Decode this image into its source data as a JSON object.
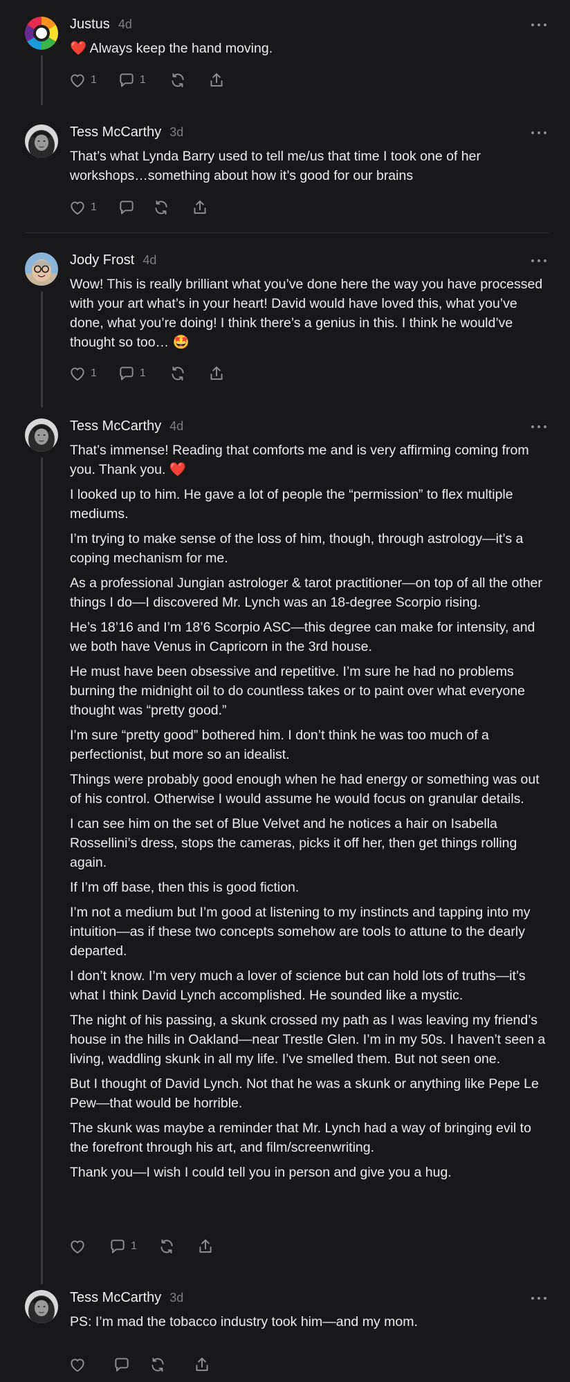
{
  "comments": [
    {
      "author": "Justus",
      "time": "4d",
      "paragraphs": [
        "❤️ Always keep the hand moving."
      ],
      "like_count": "1",
      "reply_count": "1"
    },
    {
      "author": "Tess McCarthy",
      "time": "3d",
      "paragraphs": [
        "That’s what Lynda Barry used to tell me/us that time I took one of her workshops…something about how it’s good for our brains"
      ],
      "like_count": "1",
      "reply_count": ""
    },
    {
      "author": "Jody Frost",
      "time": "4d",
      "paragraphs": [
        "Wow! This is really brilliant what you’ve done here the way you have processed with your art what’s in your heart! David would have loved this, what you’ve done, what you’re doing! I think there’s a genius in this. I think he would’ve thought so too… 🤩"
      ],
      "like_count": "1",
      "reply_count": "1"
    },
    {
      "author": "Tess McCarthy",
      "time": "4d",
      "paragraphs": [
        "That’s immense! Reading that comforts me and is very affirming coming from you. Thank you. ❤️",
        "I looked up to him. He gave a lot of people the “permission” to flex multiple mediums.",
        "I’m trying to make sense of the loss of him, though, through astrology—it’s a coping mechanism for me.",
        "As a professional Jungian astrologer & tarot practitioner—on top of all the other things I do—I discovered Mr. Lynch was an 18-degree Scorpio rising.",
        "He’s 18’16 and I’m 18’6 Scorpio ASC—this degree can make for intensity, and we both have Venus in Capricorn in the 3rd house.",
        "He must have been obsessive and repetitive. I’m sure he had no problems burning the midnight oil to do countless takes or to paint over what everyone thought was “pretty good.”",
        "I’m sure “pretty good” bothered him. I don’t think he was too much of a perfectionist, but more so an idealist.",
        "Things were probably good enough when he had energy or something was out of his control. Otherwise I would assume he would focus on granular details.",
        "I can see him on the set of Blue Velvet and he notices a hair on Isabella Rossellini’s dress, stops the cameras, picks it off her, then get things rolling again.",
        "If I’m off base, then this is good fiction.",
        "I’m not a medium but I’m good at listening to my instincts and tapping into my intuition—as if these two concepts somehow are tools to attune to the dearly departed.",
        "I don’t know. I’m very much a lover of science but can hold lots of truths—it’s what I think David Lynch accomplished. He sounded like a mystic.",
        "The night of his passing, a skunk crossed my path as I was leaving my friend’s house in the hills in Oakland—near Trestle Glen. I’m in my 50s. I haven’t seen a living, waddling skunk in all my life. I’ve smelled them. But not seen one.",
        "But I thought of David Lynch. Not that he was a skunk or anything like Pepe Le Pew—that would be horrible.",
        "The skunk was maybe a reminder that Mr. Lynch had a way of bringing evil to the forefront through his art, and film/screenwriting.",
        "Thank you—I wish I could tell you in person and give you a hug."
      ],
      "like_count": "",
      "reply_count": "1"
    },
    {
      "author": "Tess McCarthy",
      "time": "3d",
      "paragraphs": [
        "PS: I’m mad the tobacco industry took him—and my mom."
      ],
      "like_count": "",
      "reply_count": ""
    }
  ],
  "colors": {
    "background": "#18181a",
    "text": "#ececed",
    "muted": "#7d7d82",
    "thread_line": "#3a3a3d"
  },
  "icons": [
    "heart-icon",
    "comment-icon",
    "restack-icon",
    "share-icon",
    "more-icon"
  ]
}
